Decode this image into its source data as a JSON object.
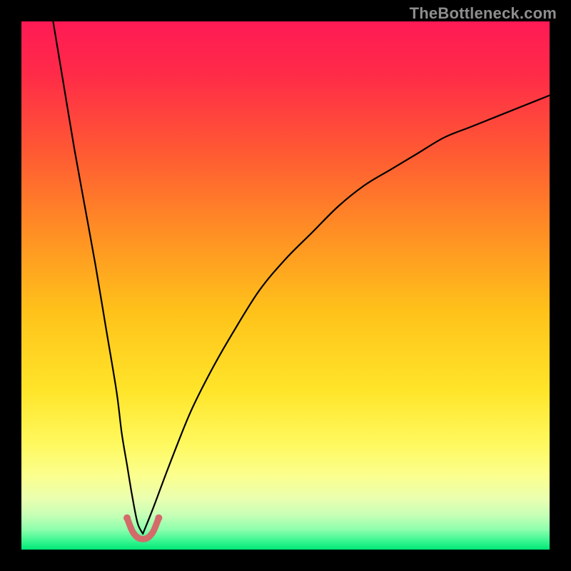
{
  "watermark": "TheBottleneck.com",
  "chart_data": {
    "type": "line",
    "title": "",
    "xlabel": "",
    "ylabel": "",
    "xlim": [
      0,
      100
    ],
    "ylim": [
      0,
      100
    ],
    "background_gradient_stops": [
      {
        "offset": 0.0,
        "color": "#ff1a55"
      },
      {
        "offset": 0.1,
        "color": "#ff2b48"
      },
      {
        "offset": 0.25,
        "color": "#ff5a33"
      },
      {
        "offset": 0.4,
        "color": "#ff8f24"
      },
      {
        "offset": 0.55,
        "color": "#ffc21a"
      },
      {
        "offset": 0.7,
        "color": "#ffe52a"
      },
      {
        "offset": 0.8,
        "color": "#fff95f"
      },
      {
        "offset": 0.86,
        "color": "#fbff8e"
      },
      {
        "offset": 0.905,
        "color": "#e9ffb0"
      },
      {
        "offset": 0.935,
        "color": "#c6ffb6"
      },
      {
        "offset": 0.962,
        "color": "#8dffad"
      },
      {
        "offset": 0.985,
        "color": "#34f58f"
      },
      {
        "offset": 1.0,
        "color": "#00e676"
      }
    ],
    "notch_x": 23,
    "series": [
      {
        "name": "left-branch",
        "x": [
          6,
          8,
          10,
          12,
          14,
          16,
          18,
          19,
          20,
          21,
          22,
          23
        ],
        "y": [
          100,
          88,
          76,
          65,
          54,
          42,
          30,
          22,
          16,
          10,
          5,
          3
        ]
      },
      {
        "name": "right-branch",
        "x": [
          23,
          25,
          28,
          32,
          36,
          40,
          45,
          50,
          55,
          60,
          65,
          70,
          75,
          80,
          85,
          90,
          95,
          100
        ],
        "y": [
          3,
          8,
          16,
          26,
          34,
          41,
          49,
          55,
          60,
          65,
          69,
          72,
          75,
          78,
          80,
          82,
          84,
          86
        ]
      }
    ],
    "notch_markers": {
      "color": "#d46a6a",
      "stroke_width": 9,
      "dot_radius": 5,
      "points": [
        {
          "x": 20.0,
          "y": 6.0
        },
        {
          "x": 21.0,
          "y": 3.5
        },
        {
          "x": 22.0,
          "y": 2.3
        },
        {
          "x": 23.0,
          "y": 2.0
        },
        {
          "x": 24.0,
          "y": 2.3
        },
        {
          "x": 25.0,
          "y": 3.5
        },
        {
          "x": 26.0,
          "y": 6.0
        }
      ]
    }
  }
}
